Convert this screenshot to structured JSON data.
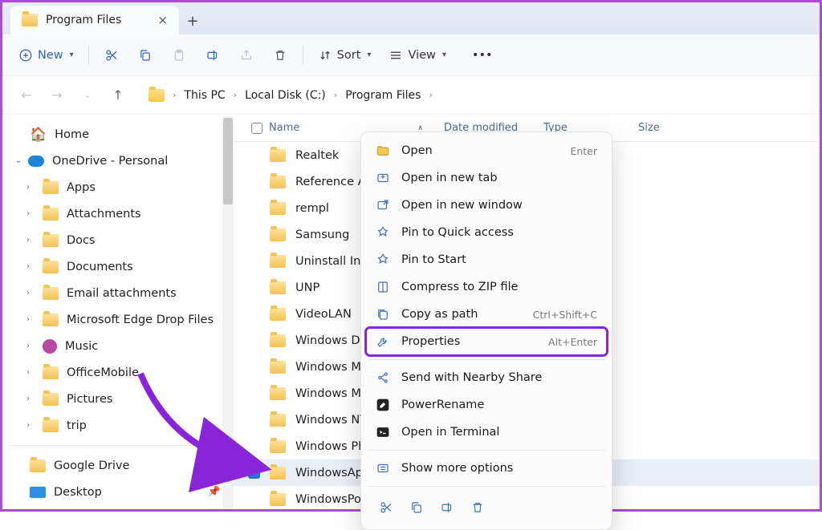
{
  "tab": {
    "title": "Program Files"
  },
  "toolbar": {
    "new_label": "New",
    "sort_label": "Sort",
    "view_label": "View"
  },
  "breadcrumb": {
    "items": [
      "This PC",
      "Local Disk (C:)",
      "Program Files"
    ]
  },
  "columns": {
    "name": "Name",
    "date": "Date modified",
    "type": "Type",
    "size": "Size"
  },
  "sidebar": {
    "home": "Home",
    "onedrive": "OneDrive - Personal",
    "items": [
      "Apps",
      "Attachments",
      "Docs",
      "Documents",
      "Email attachments",
      "Microsoft Edge Drop Files",
      "Music",
      "OfficeMobile",
      "Pictures",
      "trip"
    ],
    "pinned": [
      "Google Drive",
      "Desktop"
    ]
  },
  "files": [
    "Realtek",
    "Reference Assemb",
    "rempl",
    "Samsung",
    "Uninstall Informati",
    "UNP",
    "VideoLAN",
    "Windows Defende",
    "Windows Mail",
    "Windows Media Pl",
    "Windows NT",
    "Windows Photo Vi",
    "WindowsApps",
    "WindowsPowerShe"
  ],
  "selected_index": 12,
  "context_menu": {
    "items": [
      {
        "label": "Open",
        "shortcut": "Enter",
        "icon": "folder"
      },
      {
        "label": "Open in new tab",
        "icon": "newtab"
      },
      {
        "label": "Open in new window",
        "icon": "newwin"
      },
      {
        "label": "Pin to Quick access",
        "icon": "pin"
      },
      {
        "label": "Pin to Start",
        "icon": "pin"
      },
      {
        "label": "Compress to ZIP file",
        "icon": "zip"
      },
      {
        "label": "Copy as path",
        "shortcut": "Ctrl+Shift+C",
        "icon": "copypath"
      },
      {
        "label": "Properties",
        "shortcut": "Alt+Enter",
        "icon": "wrench",
        "highlight": true
      },
      {
        "sep": true
      },
      {
        "label": "Send with Nearby Share",
        "icon": "share"
      },
      {
        "label": "PowerRename",
        "icon": "rename"
      },
      {
        "label": "Open in Terminal",
        "icon": "terminal"
      },
      {
        "sep": true
      },
      {
        "label": "Show more options",
        "icon": "more"
      }
    ]
  },
  "annotation": {
    "highlight_item": "Properties"
  }
}
